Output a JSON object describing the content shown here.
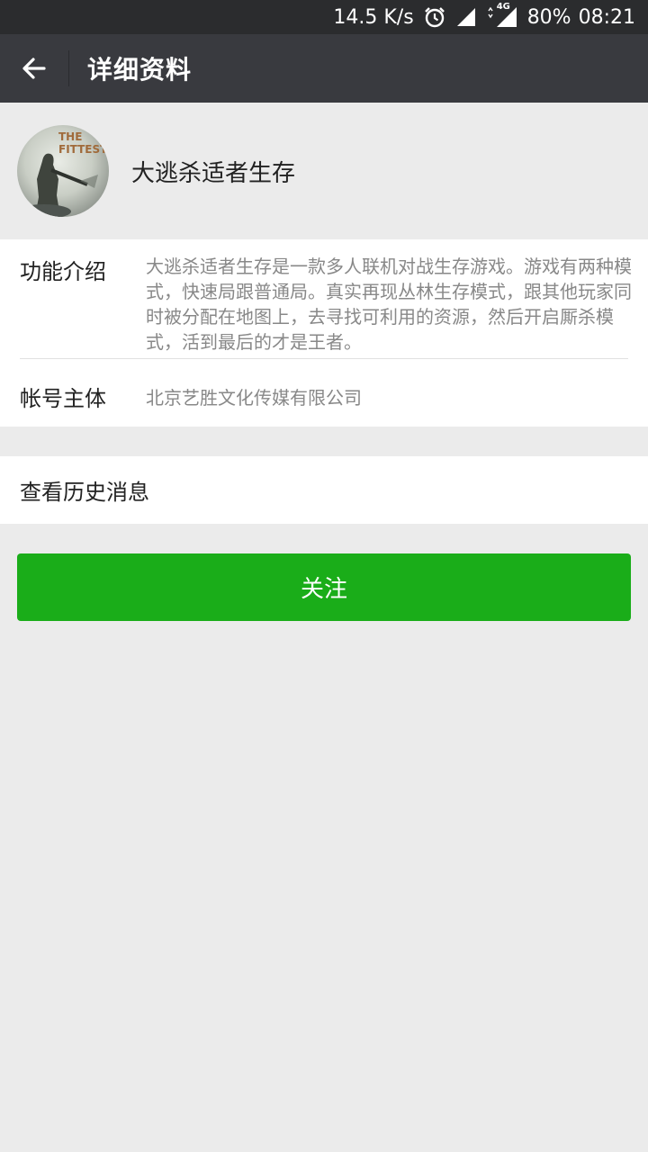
{
  "status_bar": {
    "network_speed": "14.5 K/s",
    "network_type": "4G",
    "battery": "80%",
    "time": "08:21",
    "icons": [
      "alarm-icon",
      "signal-icon",
      "signal-4g-icon"
    ]
  },
  "nav": {
    "back_icon": "arrow-left-icon",
    "title": "详细资料"
  },
  "profile": {
    "avatar_text": "THE FITTEST",
    "name": "大逃杀适者生存"
  },
  "info": {
    "intro_label": "功能介绍",
    "intro_text": "大逃杀适者生存是一款多人联机对战生存游戏。游戏有两种模式，快速局跟普通局。真实再现丛林生存模式，跟其他玩家同时被分配在地图上，去寻找可利用的资源，然后开启厮杀模式，活到最后的才是王者。",
    "owner_label": "帐号主体",
    "owner_text": "北京艺胜文化传媒有限公司"
  },
  "history": {
    "label": "查看历史消息"
  },
  "follow_button": {
    "label": "关注"
  },
  "colors": {
    "status_bar_bg": "#2b2c2e",
    "title_bar_bg": "#393a3f",
    "page_bg": "#ebebeb",
    "accent_green": "#1aad19"
  }
}
